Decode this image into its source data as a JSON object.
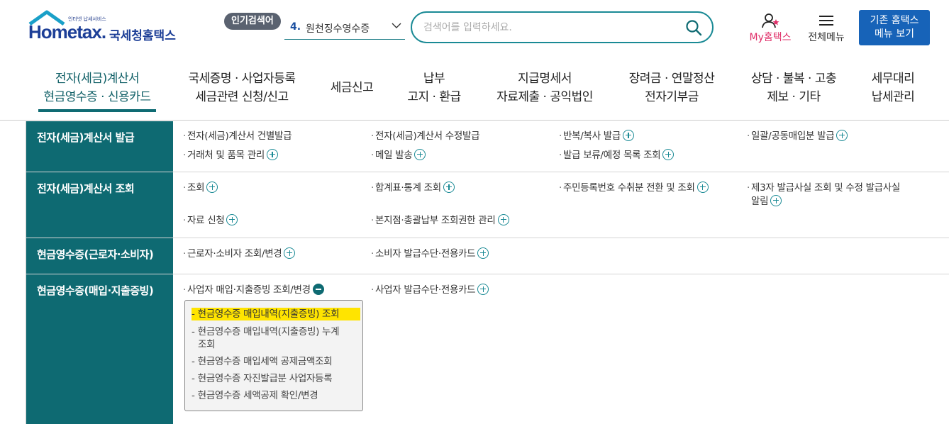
{
  "logo": {
    "tagline": "인터넷 납세서비스",
    "wordmark": "Hometax.",
    "name": "국세청홈택스"
  },
  "popular": {
    "badge": "인기검색어",
    "rank": "4.",
    "term": "원천징수영수증"
  },
  "search": {
    "placeholder": "검색어를 입력하세요."
  },
  "utility": {
    "my": "My홈택스",
    "all_menu": "전체메뉴",
    "old_line1": "기존 홈택스",
    "old_line2": "메뉴 보기"
  },
  "gnb": [
    {
      "line1": "전자(세금)계산서",
      "line2": "현금영수증 · 신용카드"
    },
    {
      "line1": "국세증명 · 사업자등록",
      "line2": "세금관련 신청/신고"
    },
    {
      "line1": "세금신고",
      "line2": ""
    },
    {
      "line1": "납부",
      "line2": "고지 · 환급"
    },
    {
      "line1": "지급명세서",
      "line2": "자료제출 · 공익법인"
    },
    {
      "line1": "장려금 · 연말정산",
      "line2": "전자기부금"
    },
    {
      "line1": "상담 · 불복 · 고충",
      "line2": "제보 · 기타"
    },
    {
      "line1": "세무대리",
      "line2": "납세관리"
    }
  ],
  "sections": [
    {
      "head": "전자(세금)계산서 발급",
      "items": [
        "전자(세금)계산서 건별발급",
        "전자(세금)계산서 수정발급",
        "반복/복사 발급",
        "일괄/공동매입분 발급",
        "거래처 및 품목 관리",
        "메일 발송",
        "발급 보류/예정 목록 조회"
      ]
    },
    {
      "head": "전자(세금)계산서 조회",
      "items": [
        "조회",
        "합계표·통계 조회",
        "주민등록번호 수취분 전환 및 조회",
        "제3자 발급사실 조회 및 수정 발급사실",
        "알림",
        "자료 신청",
        "본지점·총괄납부 조회권한 관리"
      ]
    },
    {
      "head": "현금영수증(근로자·소비자)",
      "items": [
        "근로자·소비자 조회/변경",
        "소비자 발급수단·전용카드"
      ]
    },
    {
      "head": "현금영수증(매입·지출증빙)",
      "items": [
        "사업자 매입·지출증빙 조회/변경",
        "사업자 발급수단·전용카드"
      ]
    }
  ],
  "submenu": [
    "현금영수증 매입내역(지출증빙) 조회",
    "현금영수증 매입내역(지출증빙) 누계",
    "조회",
    "현금영수증 매입세액 공제금액조회",
    "현금영수증 자진발급분 사업자등록",
    "현금영수증 세액공제 확인/변경"
  ],
  "colors": {
    "accent": "#0e6a72",
    "highlight": "#ffe400",
    "brand": "#1d3f97",
    "old_button": "#1763b8",
    "my_pink": "#e0306a"
  }
}
